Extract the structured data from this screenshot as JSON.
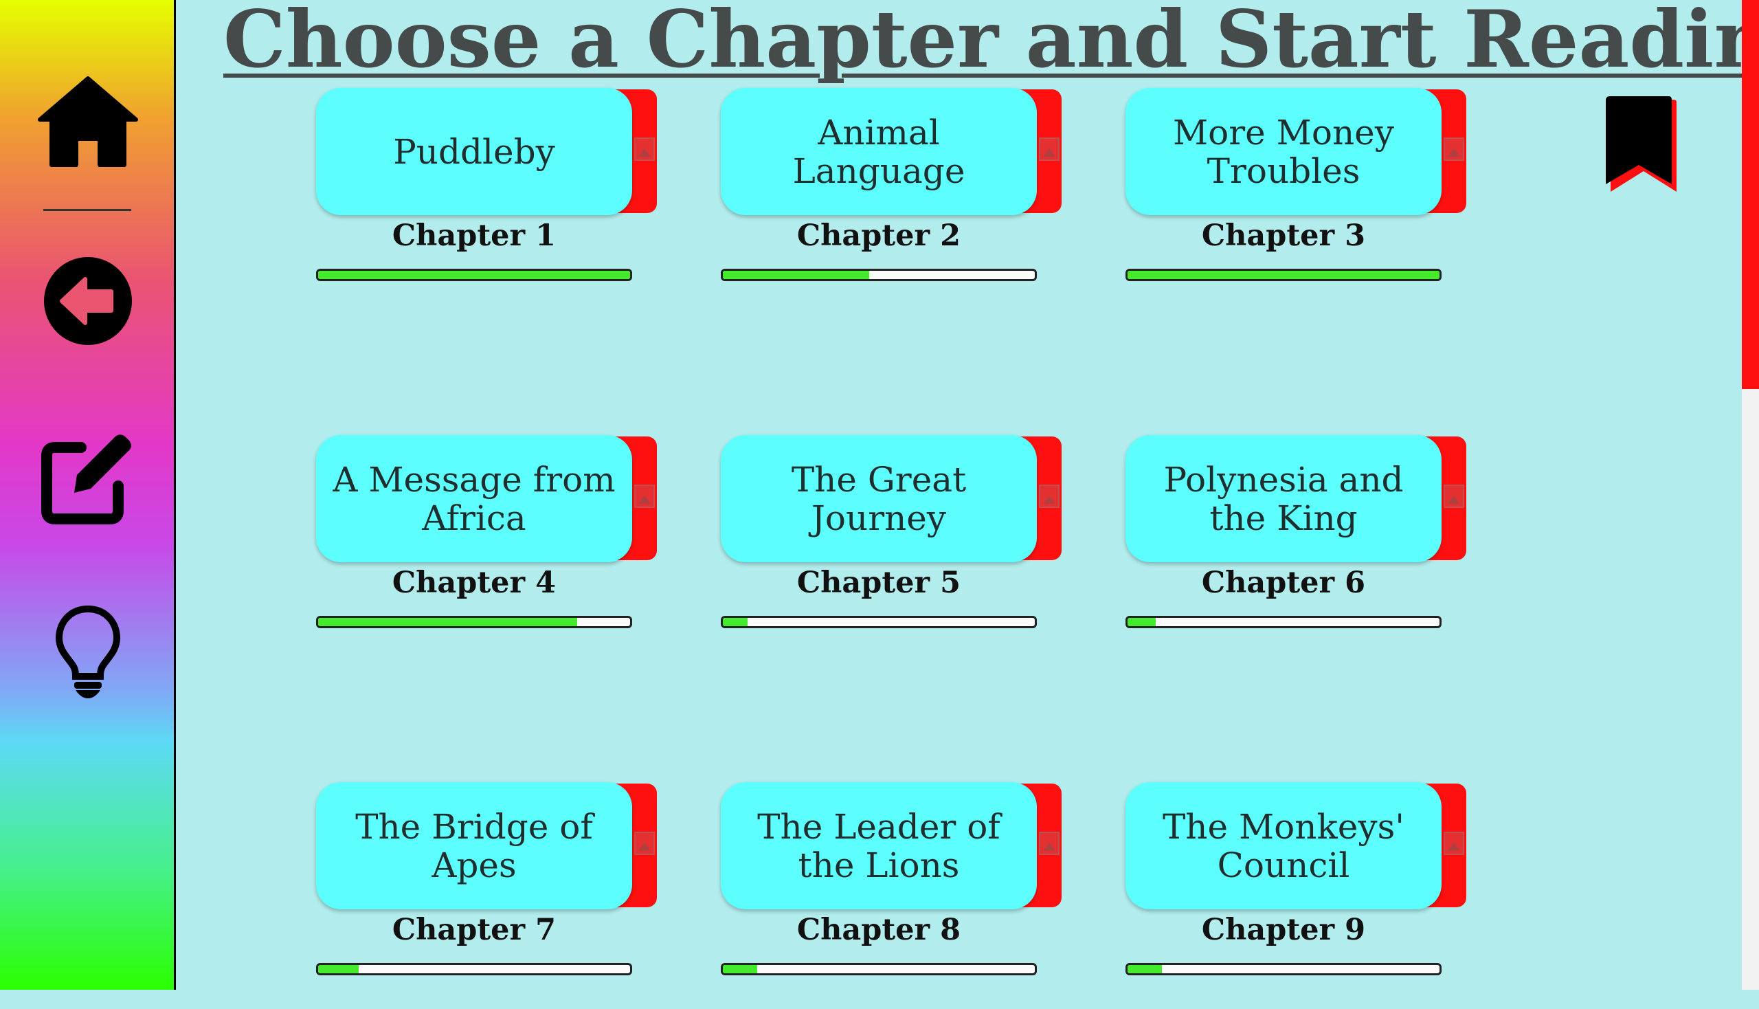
{
  "page": {
    "title": "Choose a Chapter and Start Reading"
  },
  "sidebar": {
    "buttons": [
      {
        "name": "home",
        "icon": "home-icon"
      },
      {
        "name": "back",
        "icon": "arrow-left-circle-icon"
      },
      {
        "name": "edit",
        "icon": "edit-icon"
      },
      {
        "name": "hint",
        "icon": "lightbulb-icon"
      }
    ]
  },
  "bookmark": {
    "icon": "bookmark-icon"
  },
  "chapters": [
    {
      "title": "Puddleby",
      "label": "Chapter 1",
      "progress": 1.0
    },
    {
      "title": "Animal Language",
      "label": "Chapter 2",
      "progress": 0.47
    },
    {
      "title": "More Money Troubles",
      "label": "Chapter 3",
      "progress": 1.0
    },
    {
      "title": "A Message from Africa",
      "label": "Chapter 4",
      "progress": 0.83
    },
    {
      "title": "The Great Journey",
      "label": "Chapter 5",
      "progress": 0.08
    },
    {
      "title": "Polynesia and the King",
      "label": "Chapter 6",
      "progress": 0.09
    },
    {
      "title": "The Bridge of Apes",
      "label": "Chapter 7",
      "progress": 0.13
    },
    {
      "title": "The Leader of the Lions",
      "label": "Chapter 8",
      "progress": 0.11
    },
    {
      "title": "The Monkeys' Council",
      "label": "Chapter 9",
      "progress": 0.11
    }
  ],
  "colors": {
    "card": "#5cfffe",
    "card_tab": "#ff1010",
    "progress_fill": "#44ea2c",
    "background": "#b2ecec",
    "scroll_thumb": "#ff1010"
  }
}
